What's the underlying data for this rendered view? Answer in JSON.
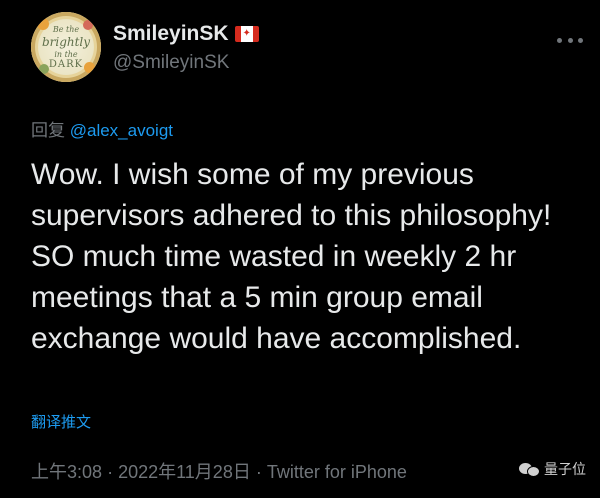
{
  "tweet": {
    "author": {
      "display_name": "SmileyinSK",
      "handle": "@SmileyinSK",
      "flag_icon": "canada-flag-icon",
      "avatar_text_lines": [
        "Be the",
        "brightly",
        "in the",
        "DARK"
      ]
    },
    "more_icon": "more-options-icon",
    "reply_label": "回复",
    "reply_to": "@alex_avoigt",
    "text": "Wow. I wish some of my previous supervisors adhered to this philosophy! SO much time wasted in weekly 2 hr meetings that a 5 min group email exchange would have accomplished.",
    "translate_label": "翻译推文",
    "time": "上午3:08",
    "separator": "·",
    "date": "2022年11月28日",
    "client": "Twitter for iPhone"
  },
  "watermark": {
    "label": "量子位",
    "icon": "wechat-icon"
  },
  "colors": {
    "background": "#000000",
    "text": "#e7e9ea",
    "secondary": "#71767b",
    "link": "#1d9bf0"
  }
}
